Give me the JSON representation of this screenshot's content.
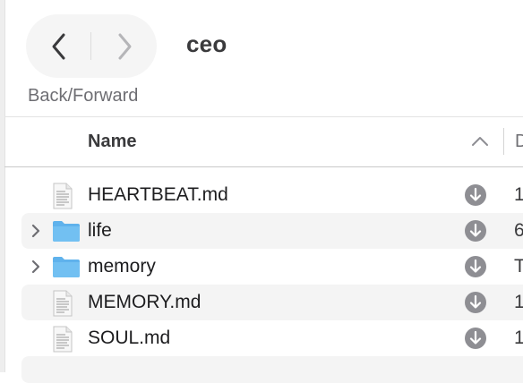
{
  "toolbar": {
    "title": "ceo",
    "nav_caption": "Back/Forward",
    "back_icon": "chevron-left-icon",
    "forward_icon": "chevron-right-icon"
  },
  "list": {
    "columns": {
      "name": "Name",
      "next_partial": "D"
    },
    "rows": [
      {
        "name": "HEARTBEAT.md",
        "kind": "document",
        "expandable": false,
        "trailing": "1"
      },
      {
        "name": "life",
        "kind": "folder",
        "expandable": true,
        "trailing": "6"
      },
      {
        "name": "memory",
        "kind": "folder",
        "expandable": true,
        "trailing": "T"
      },
      {
        "name": "MEMORY.md",
        "kind": "document",
        "expandable": false,
        "trailing": "1"
      },
      {
        "name": "SOUL.md",
        "kind": "document",
        "expandable": false,
        "trailing": "1"
      }
    ]
  },
  "colors": {
    "folder": "#5fb2ec",
    "download_badge": "#8e8e93",
    "row_alt": "#f4f4f4"
  }
}
